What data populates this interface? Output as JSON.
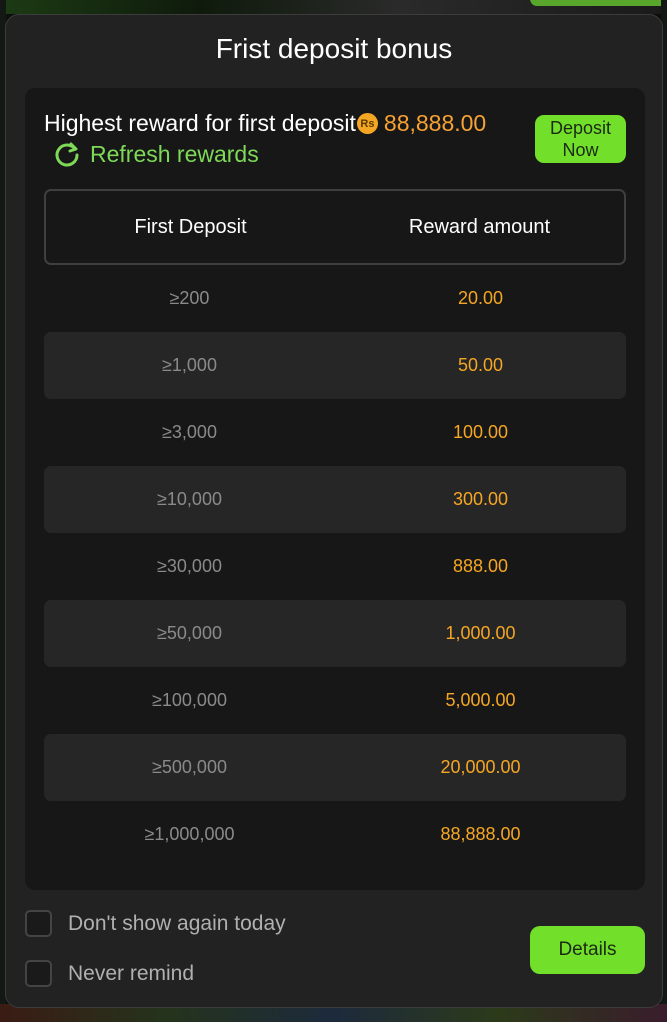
{
  "modal": {
    "title": "Frist deposit bonus"
  },
  "header": {
    "highest_label": "Highest reward for first deposit",
    "currency_icon": "rupee-coin-icon",
    "currency_symbol": "Rs",
    "highest_amount": "88,888.00",
    "refresh_label": "Refresh rewards",
    "deposit_button": "Deposit Now"
  },
  "table": {
    "columns": [
      "First Deposit",
      "Reward amount"
    ],
    "rows": [
      {
        "deposit": "≥200",
        "reward": "20.00"
      },
      {
        "deposit": "≥1,000",
        "reward": "50.00"
      },
      {
        "deposit": "≥3,000",
        "reward": "100.00"
      },
      {
        "deposit": "≥10,000",
        "reward": "300.00"
      },
      {
        "deposit": "≥30,000",
        "reward": "888.00"
      },
      {
        "deposit": "≥50,000",
        "reward": "1,000.00"
      },
      {
        "deposit": "≥100,000",
        "reward": "5,000.00"
      },
      {
        "deposit": "≥500,000",
        "reward": "20,000.00"
      },
      {
        "deposit": "≥1,000,000",
        "reward": "88,888.00"
      }
    ]
  },
  "footer": {
    "dont_show_today": "Don't show again today",
    "never_remind": "Never remind",
    "details_button": "Details"
  },
  "colors": {
    "accent_green": "#72e02a",
    "reward_orange": "#f5a623",
    "modal_bg": "#222222",
    "panel_bg": "#171717"
  }
}
